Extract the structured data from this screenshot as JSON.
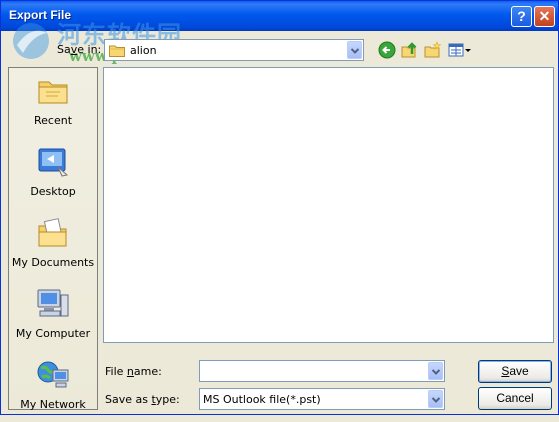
{
  "window": {
    "title": "Export File",
    "help_glyph": "?",
    "close_glyph": "✕"
  },
  "watermark": {
    "cn_text": "河东软件园",
    "url": "www.pc0359.cn"
  },
  "toolbar": {
    "save_in_label_pre": "Sa",
    "save_in_label_u": "v",
    "save_in_label_post": "e in:",
    "save_in_value": "alion",
    "icons": [
      "back-icon",
      "up-folder-icon",
      "new-folder-icon",
      "views-menu-icon"
    ]
  },
  "places": [
    {
      "label": "Recent",
      "icon": "recent-icon"
    },
    {
      "label": "Desktop",
      "icon": "desktop-icon"
    },
    {
      "label": "My Documents",
      "icon": "my-documents-icon"
    },
    {
      "label": "My Computer",
      "icon": "my-computer-icon"
    },
    {
      "label": "My Network",
      "icon": "my-network-icon"
    }
  ],
  "form": {
    "file_name_label_pre": "File ",
    "file_name_label_u": "n",
    "file_name_label_post": "ame:",
    "file_name_value": "",
    "save_type_label_pre": "Save as ",
    "save_type_label_u": "t",
    "save_type_label_post": "ype:",
    "save_type_value": "MS Outlook file(*.pst)"
  },
  "buttons": {
    "save_u": "S",
    "save_post": "ave",
    "cancel": "Cancel"
  }
}
